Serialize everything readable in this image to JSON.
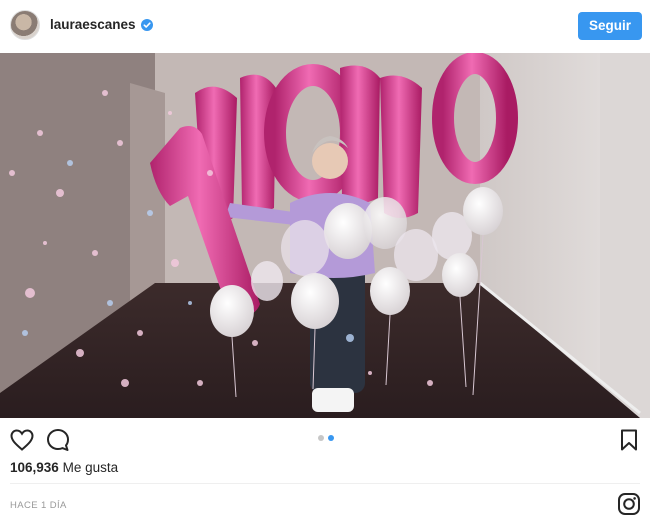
{
  "post": {
    "username": "lauraescanes",
    "verified": true,
    "follow_label": "Seguir",
    "likes_count": "106,936",
    "likes_label": "Me gusta",
    "timestamp": "HACE 1 DÍA",
    "carousel": {
      "count": 2,
      "active": 2
    }
  },
  "icons": {
    "avatar": "profile-avatar",
    "verified": "verified-badge-icon",
    "like": "heart-icon",
    "comment": "comment-icon",
    "save": "bookmark-icon",
    "brand": "instagram-logo-icon"
  },
  "colors": {
    "accent": "#3897f0",
    "text": "#262626",
    "muted": "#999999"
  }
}
